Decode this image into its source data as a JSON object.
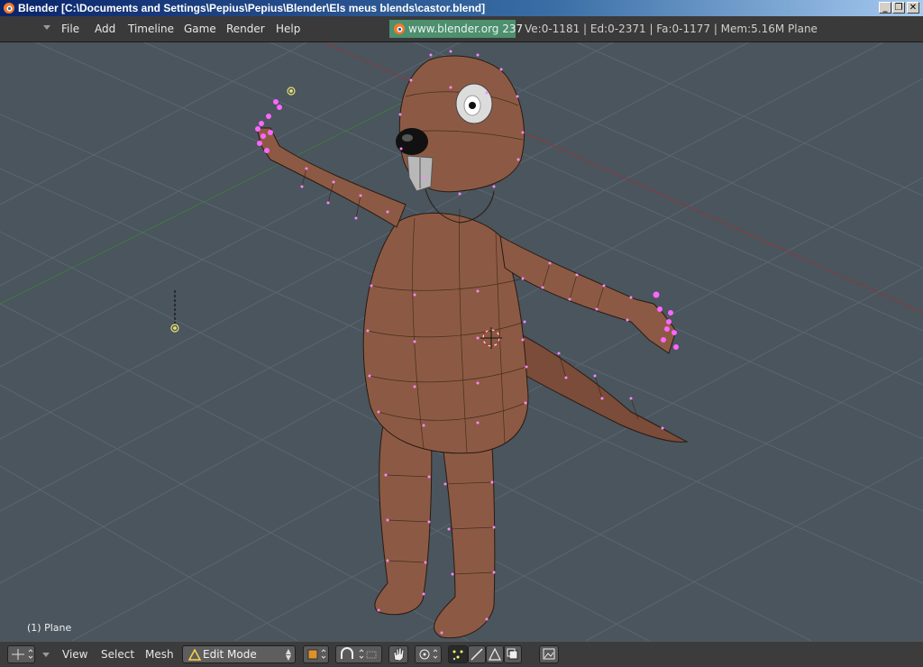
{
  "window": {
    "title": "Blender [C:\\Documents and Settings\\Pepius\\Pepius\\Blender\\Els meus blends\\castor.blend]",
    "controls": [
      "_",
      "❐",
      "✕"
    ]
  },
  "menu": {
    "items": [
      "File",
      "Add",
      "Timeline",
      "Game",
      "Render",
      "Help"
    ]
  },
  "header": {
    "link": "www.blender.org 237",
    "stats": "Ve:0-1181 | Ed:0-2371 | Fa:0-1177 | Mem:5.16M Plane"
  },
  "viewport": {
    "object_label": "(1) Plane"
  },
  "toolbar": {
    "view": "View",
    "select": "Select",
    "mesh": "Mesh",
    "mode": "Edit Mode"
  },
  "colors": {
    "viewport_bg": "#4a555e",
    "mesh_body": "#8c5a44",
    "vertex": "#ff66ff",
    "link_bg": "#4d8f6e"
  }
}
